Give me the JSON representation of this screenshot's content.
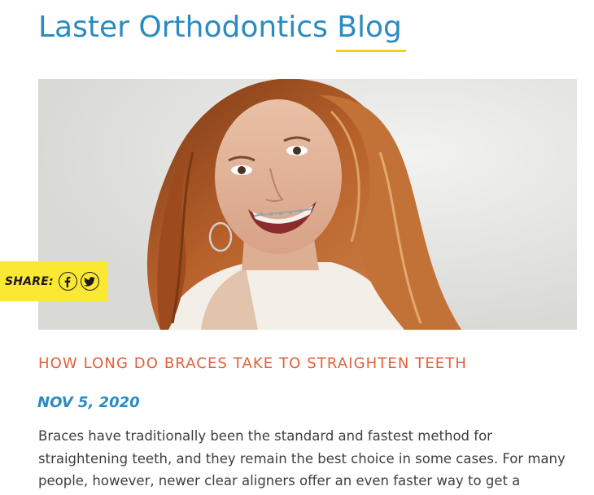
{
  "blog": {
    "title": "Laster Orthodontics Blog"
  },
  "share": {
    "label": "SHARE:",
    "buttons": [
      {
        "icon": "facebook-icon"
      },
      {
        "icon": "twitter-icon"
      }
    ]
  },
  "post": {
    "title": "HOW LONG DO BRACES TAKE TO STRAIGHTEN TEETH",
    "date": "NOV 5, 2020",
    "excerpt": "Braces have traditionally been the standard and fastest method for straightening teeth, and they remain the best choice in some cases. For many people, however, newer clear aligners offer an even faster way to get a"
  },
  "colors": {
    "brand_blue": "#2a8bc1",
    "accent_yellow": "#fbe832",
    "underline_yellow": "#f7d117",
    "title_orange": "#e2603a",
    "body_text": "#3e3e3e"
  }
}
